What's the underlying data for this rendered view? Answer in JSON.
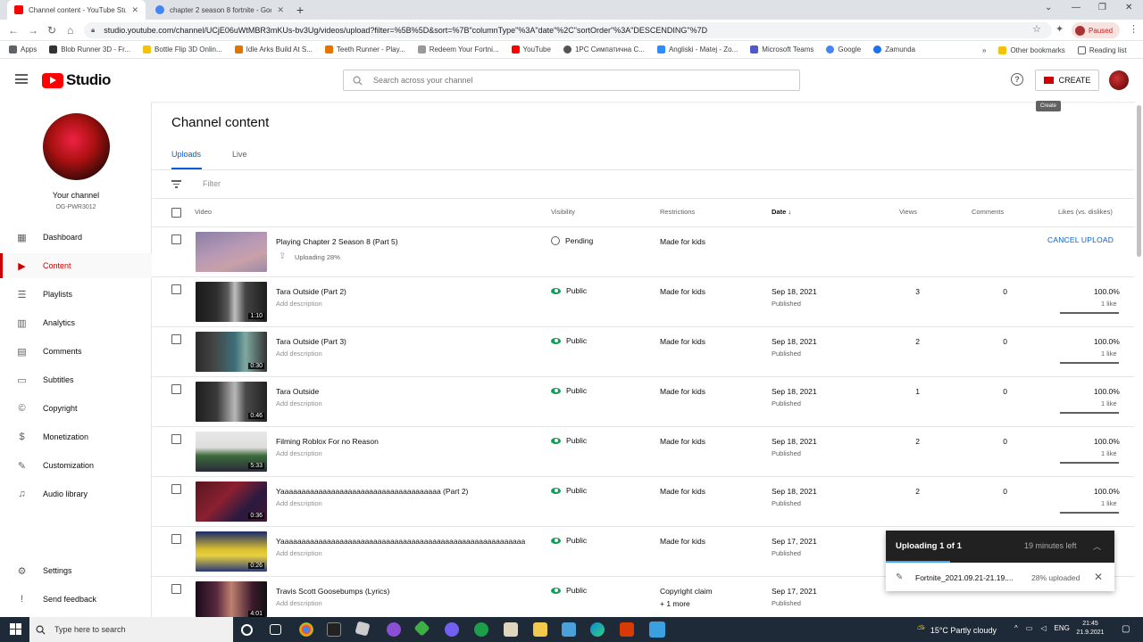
{
  "browser": {
    "tabs": [
      {
        "title": "Channel content - YouTube Studio"
      },
      {
        "title": "chapter 2 season 8 fortnite - Goo"
      }
    ],
    "url": "studio.youtube.com/channel/UCjE06uWtMBR3mKUs-bv3Ug/videos/upload?filter=%5B%5D&sort=%7B\"columnType\"%3A\"date\"%2C\"sortOrder\"%3A\"DESCENDING\"%7D",
    "profile_status": "Paused",
    "bookmarks": [
      "Apps",
      "Blob Runner 3D - Fr...",
      "Bottle Flip 3D Onlin...",
      "Idle Arks Build At S...",
      "Teeth Runner - Play...",
      "Redeem Your Fortni...",
      "YouTube",
      "1PC Симпатична С...",
      "Angliski - Matej - Zo...",
      "Microsoft Teams",
      "Google",
      "Zamunda"
    ],
    "bookmarks_more": "»",
    "other_bookmarks": "Other bookmarks",
    "reading_list": "Reading list"
  },
  "studio": {
    "logo_text": "Studio",
    "search_placeholder": "Search across your channel",
    "create_label": "CREATE",
    "create_tooltip": "Create"
  },
  "sidebar": {
    "channel_name": "Your channel",
    "channel_handle": "OG-PWR3012",
    "items": [
      {
        "label": "Dashboard",
        "icon": "dashboard-icon"
      },
      {
        "label": "Content",
        "icon": "content-icon"
      },
      {
        "label": "Playlists",
        "icon": "playlists-icon"
      },
      {
        "label": "Analytics",
        "icon": "analytics-icon"
      },
      {
        "label": "Comments",
        "icon": "comments-icon"
      },
      {
        "label": "Subtitles",
        "icon": "subtitles-icon"
      },
      {
        "label": "Copyright",
        "icon": "copyright-icon"
      },
      {
        "label": "Monetization",
        "icon": "monetization-icon"
      },
      {
        "label": "Customization",
        "icon": "customization-icon"
      },
      {
        "label": "Audio library",
        "icon": "audio-library-icon"
      }
    ],
    "bottom_items": [
      {
        "label": "Settings",
        "icon": "settings-icon"
      },
      {
        "label": "Send feedback",
        "icon": "feedback-icon"
      }
    ]
  },
  "main": {
    "title": "Channel content",
    "tabs": [
      {
        "label": "Uploads"
      },
      {
        "label": "Live"
      }
    ],
    "filter_placeholder": "Filter",
    "columns": {
      "video": "Video",
      "visibility": "Visibility",
      "restrictions": "Restrictions",
      "date": "Date",
      "views": "Views",
      "comments": "Comments",
      "likes": "Likes (vs. dislikes)"
    },
    "cancel_upload": "CANCEL UPLOAD",
    "rows": [
      {
        "title": "Playing Chapter 2 Season 8 (Part 5)",
        "desc": "Uploading 28%",
        "duration": "",
        "visibility": "Pending",
        "restriction": "Made for kids",
        "restriction2": "",
        "date": "",
        "status": "",
        "views": "",
        "comments": "",
        "likes_pct": "",
        "likes_count": "",
        "upload_progress": 0.28
      },
      {
        "title": "Tara Outside (Part 2)",
        "desc": "Add description",
        "duration": "1:10",
        "visibility": "Public",
        "restriction": "Made for kids",
        "restriction2": "",
        "date": "Sep 18, 2021",
        "status": "Published",
        "views": "3",
        "comments": "0",
        "likes_pct": "100.0%",
        "likes_count": "1 like",
        "like_ratio": 1.0
      },
      {
        "title": "Tara Outside (Part 3)",
        "desc": "Add description",
        "duration": "0:30",
        "visibility": "Public",
        "restriction": "Made for kids",
        "restriction2": "",
        "date": "Sep 18, 2021",
        "status": "Published",
        "views": "2",
        "comments": "0",
        "likes_pct": "100.0%",
        "likes_count": "1 like",
        "like_ratio": 1.0
      },
      {
        "title": "Tara Outside",
        "desc": "Add description",
        "duration": "0:46",
        "visibility": "Public",
        "restriction": "Made for kids",
        "restriction2": "",
        "date": "Sep 18, 2021",
        "status": "Published",
        "views": "1",
        "comments": "0",
        "likes_pct": "100.0%",
        "likes_count": "1 like",
        "like_ratio": 1.0
      },
      {
        "title": "Filming Roblox For no Reason",
        "desc": "Add description",
        "duration": "5:33",
        "visibility": "Public",
        "restriction": "Made for kids",
        "restriction2": "",
        "date": "Sep 18, 2021",
        "status": "Published",
        "views": "2",
        "comments": "0",
        "likes_pct": "100.0%",
        "likes_count": "1 like",
        "like_ratio": 1.0
      },
      {
        "title": "Yaaaaaaaaaaaaaaaaaaaaaaaaaaaaaaaaaaaaaa (Part 2)",
        "desc": "Add description",
        "duration": "0:36",
        "visibility": "Public",
        "restriction": "Made for kids",
        "restriction2": "",
        "date": "Sep 18, 2021",
        "status": "Published",
        "views": "2",
        "comments": "0",
        "likes_pct": "100.0%",
        "likes_count": "1 like",
        "like_ratio": 1.0
      },
      {
        "title": "Yaaaaaaaaaaaaaaaaaaaaaaaaaaaaaaaaaaaaaaaaaaaaaaaaaaaaaaaaaa...",
        "desc": "Add description",
        "duration": "0:26",
        "visibility": "Public",
        "restriction": "Made for kids",
        "restriction2": "",
        "date": "Sep 17, 2021",
        "status": "Published",
        "views": "",
        "comments": "",
        "likes_pct": "",
        "likes_count": ""
      },
      {
        "title": "Travis Scott Goosebumps (Lyrics)",
        "desc": "Add description",
        "duration": "4:01",
        "visibility": "Public",
        "restriction": "Copyright claim",
        "restriction2": "+ 1 more",
        "date": "Sep 17, 2021",
        "status": "Published",
        "views": "2",
        "comments": "0",
        "likes_pct": "",
        "likes_count": ""
      }
    ]
  },
  "upload_panel": {
    "title": "Uploading 1 of 1",
    "time_left": "19 minutes left",
    "filename": "Fortnite_2021.09.21-21.19....",
    "progress_text": "28% uploaded",
    "progress": 0.28
  },
  "taskbar": {
    "search_placeholder": "Type here to search",
    "weather": "15°C  Partly cloudy",
    "lang": "ENG",
    "time": "21:45",
    "date": "21.9.2021"
  },
  "colors": {
    "accent": "#065fd4",
    "brand": "#ff0000",
    "active": "#cc0000",
    "public": "#0f9d58"
  }
}
